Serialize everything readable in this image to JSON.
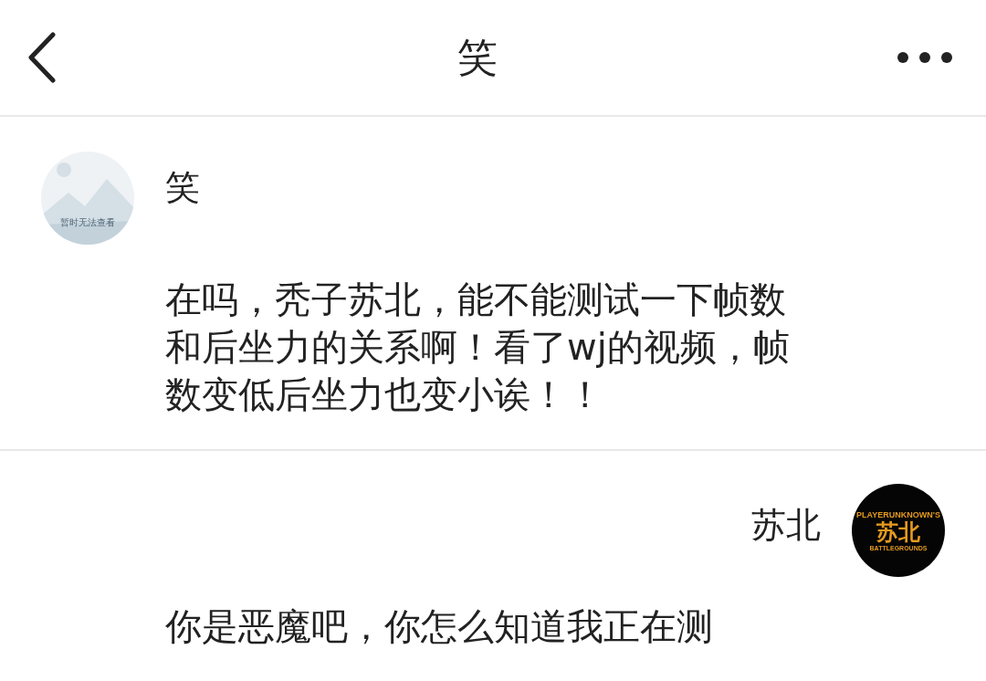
{
  "header": {
    "title": "笑"
  },
  "messages": [
    {
      "kind": "incoming",
      "sender": "笑",
      "avatar": {
        "kind": "placeholder",
        "caption": "暂时无法查看"
      },
      "text": "在吗，秃子苏北，能不能测试一下帧数和后坐力的关系啊！看了wj的视频，帧数变低后坐力也变小诶！！"
    },
    {
      "kind": "outgoing",
      "sender": "苏北",
      "avatar": {
        "kind": "logo",
        "top": "PLAYERUNKNOWN'S",
        "main": "苏北",
        "bottom": "BATTLEGROUNDS"
      },
      "text": "你是恶魔吧，你怎么知道我正在测"
    }
  ]
}
